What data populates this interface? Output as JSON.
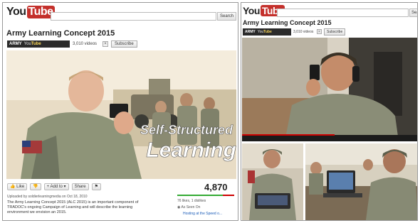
{
  "left": {
    "logo": {
      "you": "You",
      "tube": "Tube"
    },
    "search_button": "Search",
    "channel_title": "Army Learning Concept 2015",
    "badge": {
      "army": "ARMY",
      "you": "You",
      "tube": "Tube"
    },
    "videos_count": "3,010 videos",
    "close_mark": "×",
    "subscribe_label": "Subscribe",
    "video_overlay": {
      "line1": "Self-Structured",
      "line2": "Learning"
    },
    "actions": {
      "like": "Like",
      "add_to": "Add to",
      "share": "Share"
    },
    "view_count": "4,870",
    "uploaded_by": "Uploaded by soldierlearningmedia on Oct 18, 2010",
    "description_lines": [
      "The Army Learning Concept 2015 (ALC 2015) is an important component of",
      "TRADOC's ongoing Campaign of Learning and will describe the learning",
      "environment we envision an 2015."
    ],
    "likes_text": "76 likes, 1 dislikes",
    "as_seen_on": "As Seen On",
    "hosting": "Hosting at the Speed o..."
  },
  "right": {
    "logo": {
      "you": "You",
      "tube": "Tube"
    },
    "search_button": "Sear",
    "channel_title": "Army Learning Concept 2015",
    "badge": {
      "army": "ARMY",
      "you": "You",
      "tube": "Tube"
    },
    "videos_count": "3,010 videos",
    "close_mark": "×",
    "subscribe_label": "Subscribe"
  },
  "colors": {
    "youtube_red": "#c4302b",
    "rating_green": "#33aa33",
    "rating_red": "#cc0000"
  },
  "rating_fraction": 0.8
}
